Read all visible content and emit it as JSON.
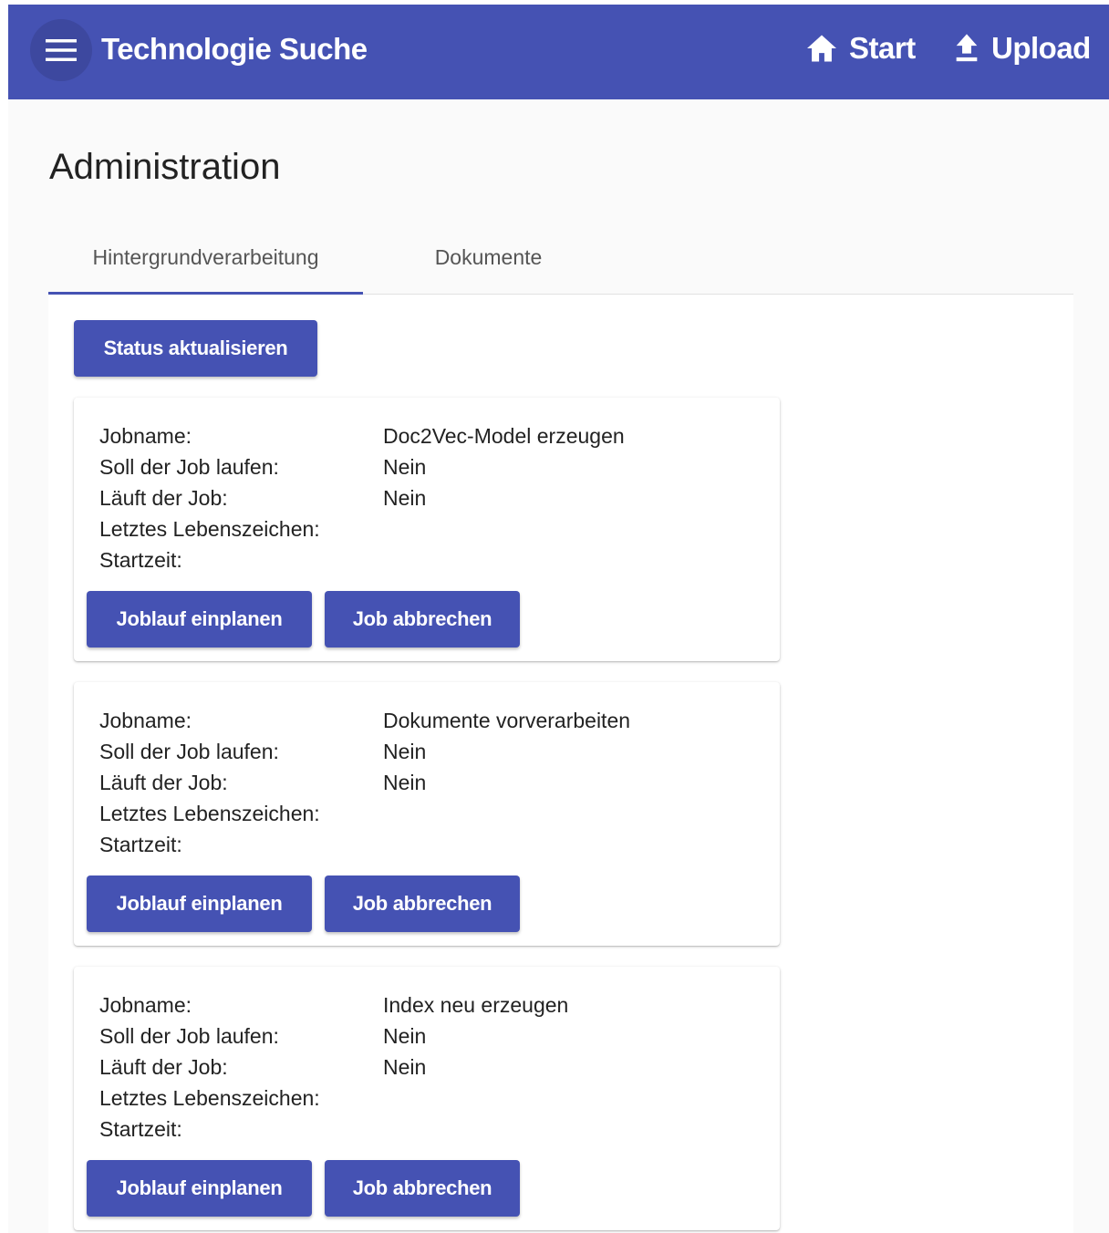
{
  "toolbar": {
    "title": "Technologie Suche",
    "nav": [
      {
        "label": "Start",
        "icon": "home-icon"
      },
      {
        "label": "Upload",
        "icon": "upload-icon"
      }
    ],
    "background": "#4552b3"
  },
  "page": {
    "title": "Administration"
  },
  "tabs": [
    {
      "label": "Hintergrundverarbeitung",
      "active": true
    },
    {
      "label": "Dokumente",
      "active": false
    }
  ],
  "panel": {
    "refresh_label": "Status aktualisieren",
    "field_labels": {
      "jobname": "Jobname:",
      "should_run": "Soll der Job laufen:",
      "running": "Läuft der Job:",
      "heartbeat": "Letztes Lebenszeichen:",
      "start_time": "Startzeit:"
    },
    "plan_label": "Joblauf einplanen",
    "cancel_label": "Job abbrechen",
    "jobs": [
      {
        "jobname": "Doc2Vec-Model erzeugen",
        "should_run": "Nein",
        "running": "Nein",
        "heartbeat": "",
        "start_time": ""
      },
      {
        "jobname": "Dokumente vorverarbeiten",
        "should_run": "Nein",
        "running": "Nein",
        "heartbeat": "",
        "start_time": ""
      },
      {
        "jobname": "Index neu erzeugen",
        "should_run": "Nein",
        "running": "Nein",
        "heartbeat": "",
        "start_time": ""
      }
    ]
  },
  "colors": {
    "primary": "#4552b3",
    "menu_circle": "#3d489f"
  }
}
